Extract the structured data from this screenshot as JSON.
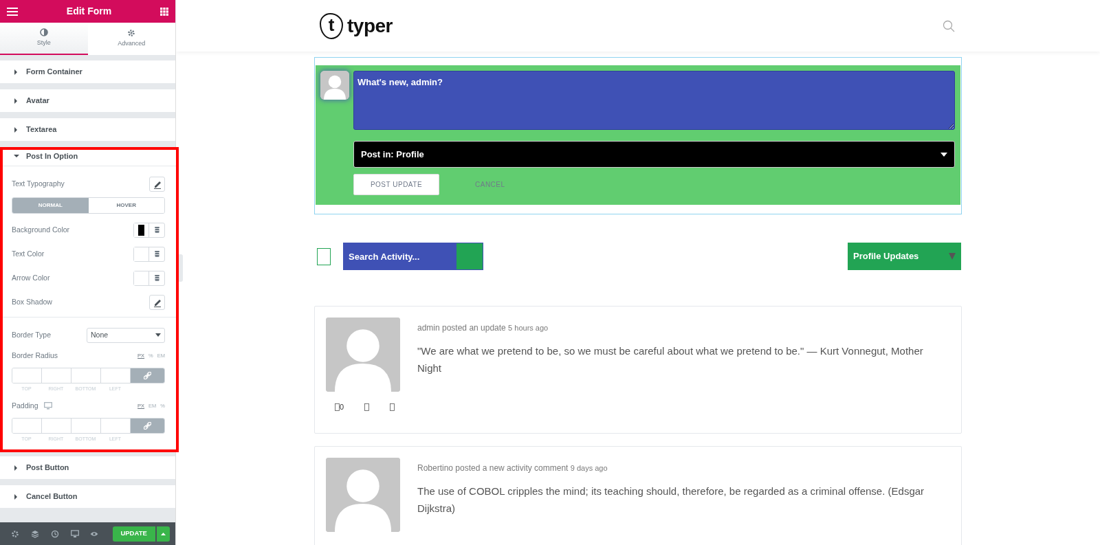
{
  "editor": {
    "title": "Edit Form",
    "tabs": [
      {
        "label": "Style",
        "selected": true
      },
      {
        "label": "Advanced",
        "selected": false
      }
    ],
    "sections": [
      {
        "label": "Form Container",
        "expanded": false,
        "highlighted": false
      },
      {
        "label": "Avatar",
        "expanded": false,
        "highlighted": false
      },
      {
        "label": "Textarea",
        "expanded": false,
        "highlighted": false
      },
      {
        "label": "Post In Option",
        "expanded": true,
        "highlighted": true,
        "controls": [
          {
            "kind": "edit",
            "label": "Text Typography"
          },
          {
            "kind": "toggle",
            "options": [
              {
                "label": "NORMAL",
                "selected": true
              },
              {
                "label": "HOVER",
                "selected": false
              }
            ]
          },
          {
            "kind": "color",
            "label": "Background Color",
            "color": "#000000"
          },
          {
            "kind": "color",
            "label": "Text Color"
          },
          {
            "kind": "color",
            "label": "Arrow Color"
          },
          {
            "kind": "edit",
            "label": "Box Shadow"
          },
          {
            "kind": "divider"
          },
          {
            "kind": "select",
            "label": "Border Type",
            "value": "None"
          },
          {
            "kind": "dimensions",
            "label": "Border Radius",
            "responsive": false,
            "linked": true,
            "units": [
              {
                "label": "PX",
                "selected": true
              },
              {
                "label": "%",
                "selected": false
              },
              {
                "label": "EM",
                "selected": false
              }
            ],
            "sides": [
              "TOP",
              "RIGHT",
              "BOTTOM",
              "LEFT"
            ]
          },
          {
            "kind": "dimensions",
            "label": "Padding",
            "responsive": true,
            "linked": true,
            "units": [
              {
                "label": "PX",
                "selected": true
              },
              {
                "label": "EM",
                "selected": false
              },
              {
                "label": "%",
                "selected": false
              }
            ],
            "sides": [
              "TOP",
              "RIGHT",
              "BOTTOM",
              "LEFT"
            ]
          }
        ]
      },
      {
        "label": "Post Button",
        "expanded": false,
        "highlighted": false
      },
      {
        "label": "Cancel Button",
        "expanded": false,
        "highlighted": false
      }
    ],
    "footer": {
      "button": "UPDATE"
    }
  },
  "site": {
    "logo": {
      "mark": "t",
      "name": "typer"
    },
    "post_form": {
      "placeholder": "What's new, admin?",
      "post_in": "Post in: Profile",
      "buttons": [
        {
          "label": "POST UPDATE",
          "kind": "primary"
        },
        {
          "label": "CANCEL",
          "kind": "link"
        }
      ]
    },
    "filters": {
      "checked": false,
      "search_placeholder": "Search Activity...",
      "show": "Profile Updates"
    },
    "activities": [
      {
        "meta": "admin posted an update",
        "time": "5 hours ago",
        "text": "\"We are what we pretend to be, so we must be careful about what we pretend to be.\" — Kurt Vonnegut, Mother Night",
        "action_count": "0"
      },
      {
        "meta": "Robertino posted a new activity comment",
        "time": "9 days ago",
        "text": "The use of COBOL cripples the mind; its teaching should, therefore, be regarded as a criminal offense. (Edsgar Dijkstra)"
      }
    ]
  }
}
